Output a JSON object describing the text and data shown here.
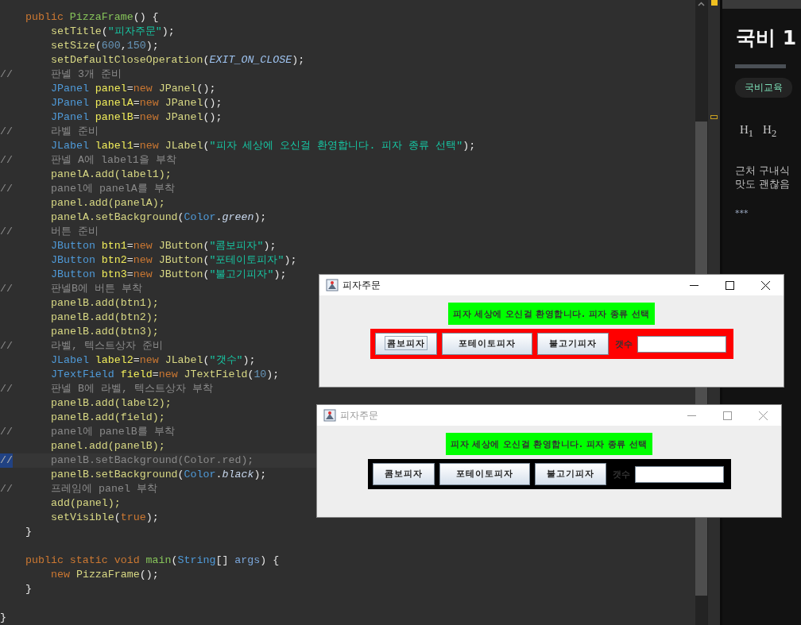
{
  "editor": {
    "lines": [
      {
        "children": [
          {
            "tokens": [
              {
                "text": "public ",
                "kind": "k"
              },
              {
                "text": "PizzaFrame",
                "kind": "g"
              },
              {
                "text": "() {",
                "kind": "p"
              }
            ],
            "children": [
              {
                "tokens": [
                  {
                    "text": "setTitle",
                    "kind": "m"
                  },
                  {
                    "text": "(",
                    "kind": "p"
                  },
                  {
                    "text": "\"피자주문\"",
                    "kind": "s"
                  },
                  {
                    "text": ");",
                    "kind": "p"
                  }
                ]
              },
              {
                "tokens": [
                  {
                    "text": "setSize",
                    "kind": "m"
                  },
                  {
                    "text": "(",
                    "kind": "p"
                  },
                  {
                    "text": "600",
                    "kind": "n"
                  },
                  {
                    "text": ",",
                    "kind": "p"
                  },
                  {
                    "text": "150",
                    "kind": "n"
                  },
                  {
                    "text": ");",
                    "kind": "p"
                  }
                ]
              },
              {
                "tokens": [
                  {
                    "text": "setDefaultCloseOperation",
                    "kind": "m"
                  },
                  {
                    "text": "(",
                    "kind": "p"
                  },
                  {
                    "text": "EXIT_ON_CLOSE",
                    "kind": "i"
                  },
                  {
                    "text": ");",
                    "kind": "p"
                  }
                ]
              },
              {
                "marker": "//",
                "highlighted": false,
                "tokens": [
                  {
                    "text": "판넬 3개 준비",
                    "kind": "c"
                  }
                ]
              },
              {
                "tokens": [
                  {
                    "text": "JPanel ",
                    "kind": "t"
                  },
                  {
                    "text": "panel",
                    "kind": "v"
                  },
                  {
                    "text": "=",
                    "kind": "p"
                  },
                  {
                    "text": "new ",
                    "kind": "k"
                  },
                  {
                    "text": "JPanel",
                    "kind": "m"
                  },
                  {
                    "text": "();",
                    "kind": "p"
                  }
                ]
              },
              {
                "tokens": [
                  {
                    "text": "JPanel ",
                    "kind": "t"
                  },
                  {
                    "text": "panelA",
                    "kind": "v"
                  },
                  {
                    "text": "=",
                    "kind": "p"
                  },
                  {
                    "text": "new ",
                    "kind": "k"
                  },
                  {
                    "text": "JPanel",
                    "kind": "m"
                  },
                  {
                    "text": "();",
                    "kind": "p"
                  }
                ]
              },
              {
                "tokens": [
                  {
                    "text": "JPanel ",
                    "kind": "t"
                  },
                  {
                    "text": "panelB",
                    "kind": "v"
                  },
                  {
                    "text": "=",
                    "kind": "p"
                  },
                  {
                    "text": "new ",
                    "kind": "k"
                  },
                  {
                    "text": "JPanel",
                    "kind": "m"
                  },
                  {
                    "text": "();",
                    "kind": "p"
                  }
                ]
              },
              {
                "marker": "//",
                "highlighted": false,
                "tokens": [
                  {
                    "text": "라벨 준비",
                    "kind": "c"
                  }
                ]
              },
              {
                "tokens": [
                  {
                    "text": "JLabel ",
                    "kind": "t"
                  },
                  {
                    "text": "label1",
                    "kind": "v"
                  },
                  {
                    "text": "=",
                    "kind": "p"
                  },
                  {
                    "text": "new ",
                    "kind": "k"
                  },
                  {
                    "text": "JLabel",
                    "kind": "m"
                  },
                  {
                    "text": "(",
                    "kind": "p"
                  },
                  {
                    "text": "\"피자 세상에 오신걸 환영합니다. 피자 종류 선택\"",
                    "kind": "s"
                  },
                  {
                    "text": ");",
                    "kind": "p"
                  }
                ]
              },
              {
                "marker": "//",
                "highlighted": false,
                "tokens": [
                  {
                    "text": "판넬 A에 label1을 부착",
                    "kind": "c"
                  }
                ]
              },
              {
                "tokens": [
                  {
                    "text": "panelA.add(label1);",
                    "kind": "m"
                  }
                ]
              },
              {
                "marker": "//",
                "highlighted": false,
                "tokens": [
                  {
                    "text": "panel에 panelA를 부착",
                    "kind": "c"
                  }
                ]
              },
              {
                "tokens": [
                  {
                    "text": "panel.add(panelA);",
                    "kind": "m"
                  }
                ]
              },
              {
                "tokens": [
                  {
                    "text": "panelA.setBackground",
                    "kind": "m"
                  },
                  {
                    "text": "(",
                    "kind": "p"
                  },
                  {
                    "text": "Color",
                    "kind": "t"
                  },
                  {
                    "text": ".",
                    "kind": "p"
                  },
                  {
                    "text": "green",
                    "kind": "f"
                  },
                  {
                    "text": ");",
                    "kind": "p"
                  }
                ]
              },
              {
                "marker": "//",
                "highlighted": false,
                "tokens": [
                  {
                    "text": "버튼 준비",
                    "kind": "c"
                  }
                ]
              },
              {
                "tokens": [
                  {
                    "text": "JButton ",
                    "kind": "t"
                  },
                  {
                    "text": "btn1",
                    "kind": "v"
                  },
                  {
                    "text": "=",
                    "kind": "p"
                  },
                  {
                    "text": "new ",
                    "kind": "k"
                  },
                  {
                    "text": "JButton",
                    "kind": "m"
                  },
                  {
                    "text": "(",
                    "kind": "p"
                  },
                  {
                    "text": "\"콤보피자\"",
                    "kind": "s"
                  },
                  {
                    "text": ");",
                    "kind": "p"
                  }
                ]
              },
              {
                "tokens": [
                  {
                    "text": "JButton ",
                    "kind": "t"
                  },
                  {
                    "text": "btn2",
                    "kind": "v"
                  },
                  {
                    "text": "=",
                    "kind": "p"
                  },
                  {
                    "text": "new ",
                    "kind": "k"
                  },
                  {
                    "text": "JButton",
                    "kind": "m"
                  },
                  {
                    "text": "(",
                    "kind": "p"
                  },
                  {
                    "text": "\"포테이토피자\"",
                    "kind": "s"
                  },
                  {
                    "text": ");",
                    "kind": "p"
                  }
                ]
              },
              {
                "tokens": [
                  {
                    "text": "JButton ",
                    "kind": "t"
                  },
                  {
                    "text": "btn3",
                    "kind": "v"
                  },
                  {
                    "text": "=",
                    "kind": "p"
                  },
                  {
                    "text": "new ",
                    "kind": "k"
                  },
                  {
                    "text": "JButton",
                    "kind": "m"
                  },
                  {
                    "text": "(",
                    "kind": "p"
                  },
                  {
                    "text": "\"불고기피자\"",
                    "kind": "s"
                  },
                  {
                    "text": ");",
                    "kind": "p"
                  }
                ]
              },
              {
                "marker": "//",
                "highlighted": false,
                "tokens": [
                  {
                    "text": "판넬B에 버튼 부착",
                    "kind": "c"
                  }
                ]
              },
              {
                "tokens": [
                  {
                    "text": "panelB.add(btn1);",
                    "kind": "m"
                  }
                ]
              },
              {
                "tokens": [
                  {
                    "text": "panelB.add(btn2);",
                    "kind": "m"
                  }
                ]
              },
              {
                "tokens": [
                  {
                    "text": "panelB.add(btn3);",
                    "kind": "m"
                  }
                ]
              },
              {
                "marker": "//",
                "highlighted": false,
                "tokens": [
                  {
                    "text": "라벨, 텍스트상자 준비",
                    "kind": "c"
                  }
                ]
              },
              {
                "tokens": [
                  {
                    "text": "JLabel ",
                    "kind": "t"
                  },
                  {
                    "text": "label2",
                    "kind": "v"
                  },
                  {
                    "text": "=",
                    "kind": "p"
                  },
                  {
                    "text": "new ",
                    "kind": "k"
                  },
                  {
                    "text": "JLabel",
                    "kind": "m"
                  },
                  {
                    "text": "(",
                    "kind": "p"
                  },
                  {
                    "text": "\"갯수\"",
                    "kind": "s"
                  },
                  {
                    "text": ");",
                    "kind": "p"
                  }
                ]
              },
              {
                "tokens": [
                  {
                    "text": "JTextField ",
                    "kind": "t"
                  },
                  {
                    "text": "field",
                    "kind": "v"
                  },
                  {
                    "text": "=",
                    "kind": "p"
                  },
                  {
                    "text": "new ",
                    "kind": "k"
                  },
                  {
                    "text": "JTextField",
                    "kind": "m"
                  },
                  {
                    "text": "(",
                    "kind": "p"
                  },
                  {
                    "text": "10",
                    "kind": "n"
                  },
                  {
                    "text": ");",
                    "kind": "p"
                  }
                ]
              },
              {
                "marker": "//",
                "highlighted": false,
                "tokens": [
                  {
                    "text": "판넬 B에 라벨, 텍스트상자 부착",
                    "kind": "c"
                  }
                ]
              },
              {
                "tokens": [
                  {
                    "text": "panelB.add(label2);",
                    "kind": "m"
                  }
                ]
              },
              {
                "tokens": [
                  {
                    "text": "panelB.add(field);",
                    "kind": "m"
                  }
                ]
              },
              {
                "marker": "//",
                "highlighted": false,
                "tokens": [
                  {
                    "text": "panel에 panelB를 부착",
                    "kind": "c"
                  }
                ]
              },
              {
                "tokens": [
                  {
                    "text": "panel.add(panelB);",
                    "kind": "m"
                  }
                ]
              },
              {
                "marker": "//",
                "highlighted": true,
                "tokens": [
                  {
                    "text": "panelB.setBackground(Color.red);",
                    "kind": "c"
                  }
                ]
              },
              {
                "tokens": [
                  {
                    "text": "panelB.setBackground",
                    "kind": "m"
                  },
                  {
                    "text": "(",
                    "kind": "p"
                  },
                  {
                    "text": "Color",
                    "kind": "t"
                  },
                  {
                    "text": ".",
                    "kind": "p"
                  },
                  {
                    "text": "black",
                    "kind": "f"
                  },
                  {
                    "text": ");",
                    "kind": "p"
                  }
                ]
              },
              {
                "marker": "//",
                "highlighted": false,
                "tokens": [
                  {
                    "text": "프레임에 panel 부착",
                    "kind": "c"
                  }
                ]
              },
              {
                "tokens": [
                  {
                    "text": "add(panel);",
                    "kind": "m"
                  }
                ]
              },
              {
                "tokens": [
                  {
                    "text": "setVisible",
                    "kind": "m"
                  },
                  {
                    "text": "(",
                    "kind": "p"
                  },
                  {
                    "text": "true",
                    "kind": "k"
                  },
                  {
                    "text": ");",
                    "kind": "p"
                  }
                ]
              }
            ]
          },
          {
            "tokens": [
              {
                "text": "}",
                "kind": "p"
              }
            ]
          },
          {
            "kind": "blank"
          },
          {
            "tokens": [
              {
                "text": "public static void ",
                "kind": "k"
              },
              {
                "text": "main",
                "kind": "g"
              },
              {
                "text": "(",
                "kind": "p"
              },
              {
                "text": "String",
                "kind": "t"
              },
              {
                "text": "[] ",
                "kind": "p"
              },
              {
                "text": "args",
                "kind": "a"
              },
              {
                "text": ") {",
                "kind": "p"
              }
            ],
            "children": [
              {
                "tokens": [
                  {
                    "text": "new ",
                    "kind": "k"
                  },
                  {
                    "text": "PizzaFrame",
                    "kind": "m"
                  },
                  {
                    "text": "();",
                    "kind": "p"
                  }
                ]
              }
            ]
          },
          {
            "tokens": [
              {
                "text": "}",
                "kind": "p"
              }
            ]
          },
          {
            "kind": "blank"
          }
        ]
      },
      {
        "tokens": [
          {
            "text": "}",
            "kind": "p"
          }
        ]
      }
    ]
  },
  "blog_preview": {
    "title": "국비 1",
    "tags": [
      "국비교육"
    ],
    "heading_buttons": [
      "H$_{1}$",
      "H$_{2}$"
    ],
    "body_lines": [
      "근처 구내식",
      "맛도 괜찮음"
    ],
    "separator": "***"
  },
  "windows": [
    {
      "title": "피자주문",
      "active": true,
      "message": "피자 세상에 오신걸 환영합니다. 피자 종류 선택",
      "color": "#ff0000",
      "buttons": [
        {
          "label": "콤보피자",
          "focused": true
        },
        {
          "label": "포테이토피자",
          "focused": false
        },
        {
          "label": "불고기피자",
          "focused": false
        }
      ],
      "count_label": "갯수"
    },
    {
      "title": "피자주문",
      "active": false,
      "message": "피자 세상에 오신걸 환영합니다. 피자 종류 선택",
      "color": "#000000",
      "buttons": [
        {
          "label": "콤보피자",
          "focused": false
        },
        {
          "label": "포테이토피자",
          "focused": false
        },
        {
          "label": "불고기피자",
          "focused": false
        }
      ],
      "count_label": "갯수"
    }
  ]
}
